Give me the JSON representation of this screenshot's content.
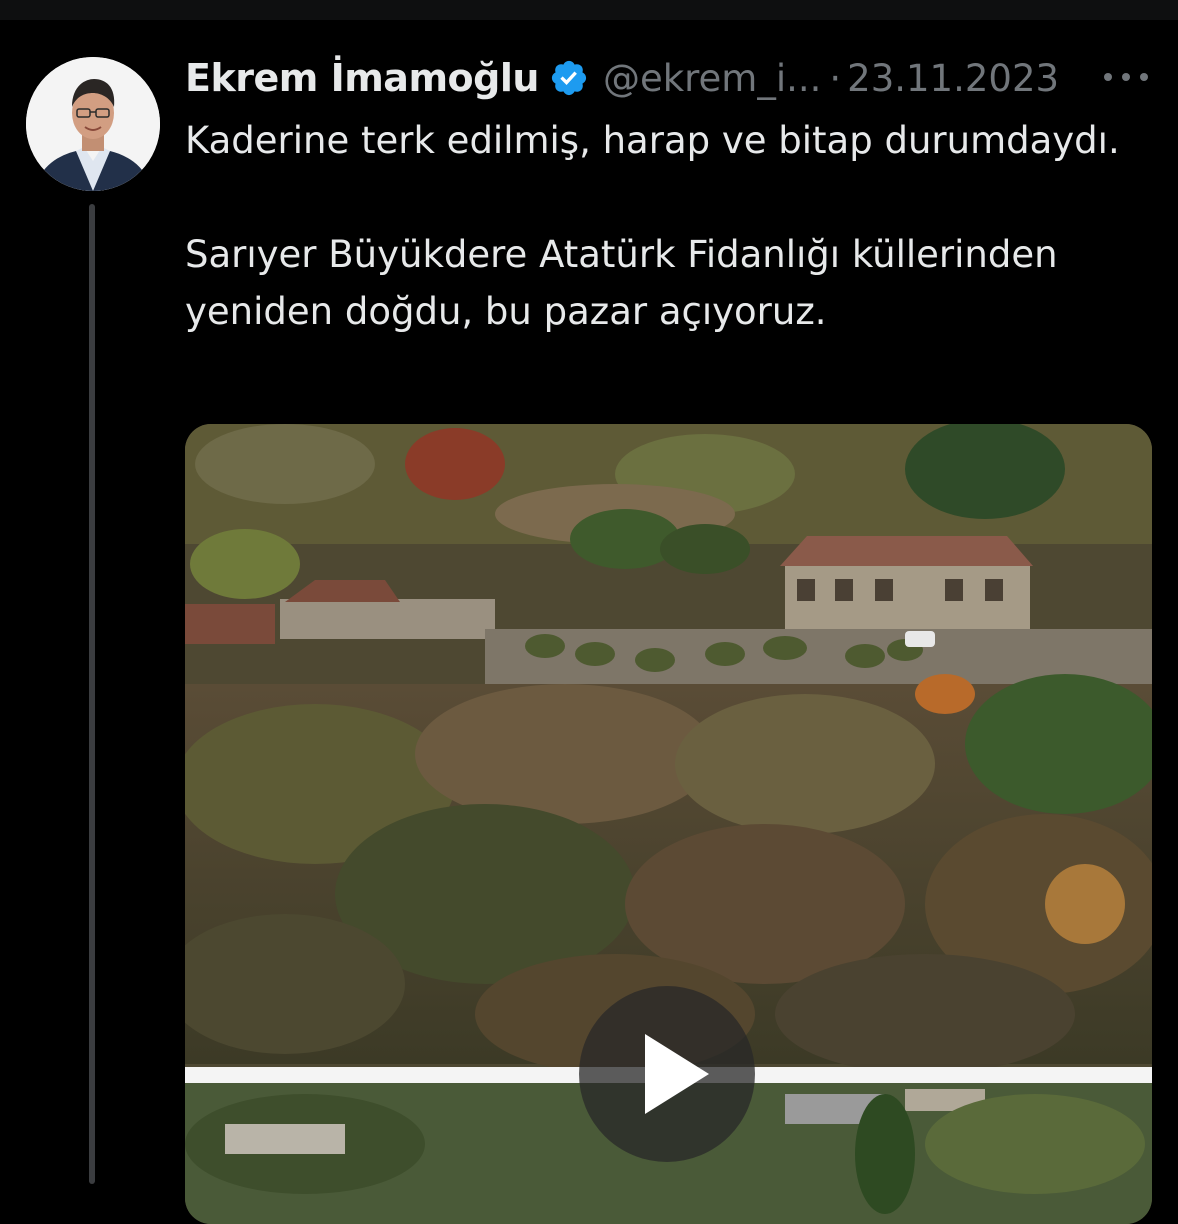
{
  "tweet": {
    "author_name": "Ekrem İmamoğlu",
    "handle": "@ekrem_i...",
    "separator": "·",
    "date": "23.11.2023",
    "text_para1": "Kaderine terk edilmiş, harap ve bitap durumdaydı.",
    "text_para2": "Sarıyer Büyükdere Atatürk Fidanlığı küllerinden yeniden doğdu, bu pazar açıyoruz."
  },
  "icons": {
    "verified": "verified-badge-icon",
    "more": "more-options-icon",
    "play": "play-icon"
  },
  "colors": {
    "background": "#000000",
    "text_primary": "#e7e9ea",
    "text_secondary": "#71767b",
    "verified_blue": "#1d9bf0",
    "thread_line": "#3b3d40"
  }
}
